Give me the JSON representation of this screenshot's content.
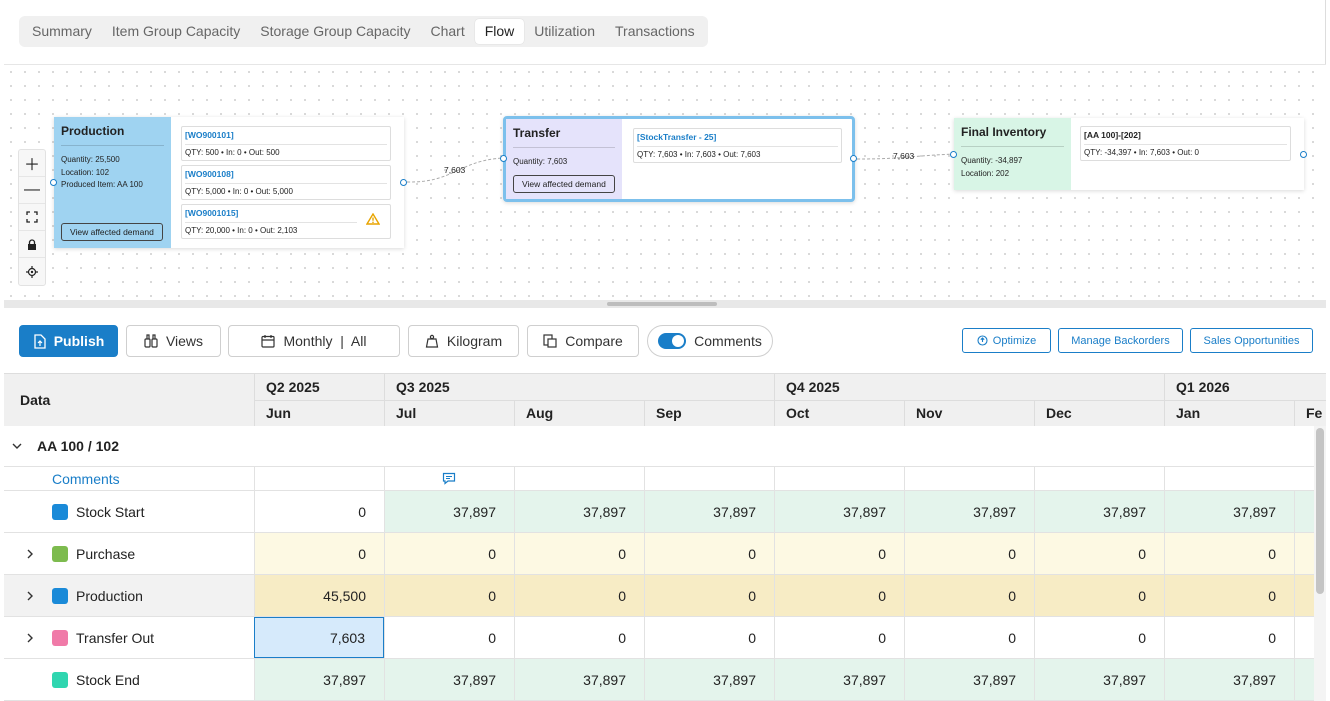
{
  "tabs": [
    "Summary",
    "Item Group Capacity",
    "Storage Group Capacity",
    "Chart",
    "Flow",
    "Utilization",
    "Transactions"
  ],
  "active_tab": "Flow",
  "flow": {
    "production": {
      "title": "Production",
      "quantity": "Quantity: 25,500",
      "location": "Location: 102",
      "produced": "Produced Item: AA 100",
      "button": "View affected demand",
      "orders": [
        {
          "id": "[WO900101]",
          "qty": "QTY: 500  •  In: 0  •  Out: 500",
          "warning": false
        },
        {
          "id": "[WO900108]",
          "qty": "QTY: 5,000  •  In: 0  •  Out: 5,000",
          "warning": false
        },
        {
          "id": "[WO9001015]",
          "qty": "QTY: 20,000  •  In: 0  •  Out: 2,103",
          "warning": true
        }
      ]
    },
    "edge1": "7,603",
    "transfer": {
      "title": "Transfer",
      "quantity": "Quantity: 7,603",
      "button": "View affected demand",
      "orders": [
        {
          "id": "[StockTransfer - 25]",
          "qty": "QTY: 7,603  •  In: 7,603  •  Out: 7,603"
        }
      ]
    },
    "edge2": "7,603",
    "final": {
      "title": "Final Inventory",
      "quantity": "Quantity: -34,897",
      "location": "Location: 202",
      "orders": [
        {
          "id": "[AA 100]-[202]",
          "qty": "QTY: -34,397  •  In: 7,603  •  Out: 0"
        }
      ]
    }
  },
  "toolbar": {
    "publish": "Publish",
    "views": "Views",
    "period": "Monthly  |  All",
    "unit": "Kilogram",
    "compare": "Compare",
    "comments": "Comments",
    "optimize": "Optimize",
    "manage_backorders": "Manage Backorders",
    "sales_opportunities": "Sales Opportunities"
  },
  "grid": {
    "data_header": "Data",
    "quarters": [
      "Q2 2025",
      "Q3 2025",
      "Q4 2025",
      "Q1 2026"
    ],
    "months": [
      "Jun",
      "Jul",
      "Aug",
      "Sep",
      "Oct",
      "Nov",
      "Dec",
      "Jan",
      "Fe"
    ],
    "group": "AA 100 / 102",
    "comments_label": "Comments",
    "rows": [
      {
        "label": "Stock Start",
        "color": "#1a8ad8",
        "expand": false,
        "values": [
          "0",
          "37,897",
          "37,897",
          "37,897",
          "37,897",
          "37,897",
          "37,897",
          "37,897"
        ]
      },
      {
        "label": "Purchase",
        "color": "#7dbb4e",
        "expand": true,
        "values": [
          "0",
          "0",
          "0",
          "0",
          "0",
          "0",
          "0",
          "0"
        ]
      },
      {
        "label": "Production",
        "color": "#1a8ad8",
        "expand": true,
        "values": [
          "45,500",
          "0",
          "0",
          "0",
          "0",
          "0",
          "0",
          "0"
        ]
      },
      {
        "label": "Transfer Out",
        "color": "#f07aa8",
        "expand": true,
        "values": [
          "7,603",
          "0",
          "0",
          "0",
          "0",
          "0",
          "0",
          "0"
        ]
      },
      {
        "label": "Stock End",
        "color": "#2fd6b0",
        "expand": false,
        "values": [
          "37,897",
          "37,897",
          "37,897",
          "37,897",
          "37,897",
          "37,897",
          "37,897",
          "37,897"
        ]
      }
    ]
  }
}
